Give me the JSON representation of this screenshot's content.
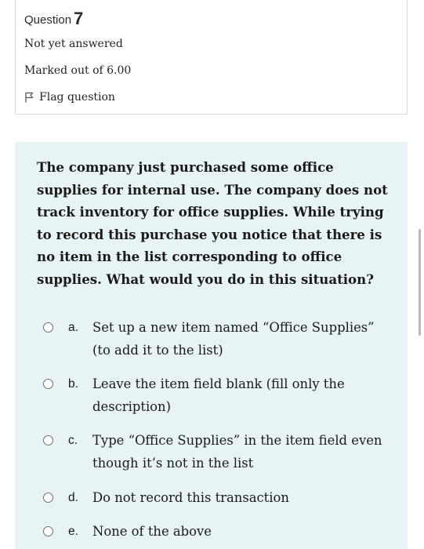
{
  "question_info": {
    "label": "Question",
    "number": "7",
    "state": "Not yet answered",
    "grade": "Marked out of 6.00",
    "flag_label": "Flag question"
  },
  "question_text": "The company just purchased some office supplies for internal use. The company does not track inventory for office supplies. While trying to record this purchase you notice that there is no item in the list corresponding to office supplies. What would you do in this situation?",
  "answers": [
    {
      "letter": "a.",
      "text": "Set up a new item named “Office Supplies” (to add it to the list)"
    },
    {
      "letter": "b.",
      "text": "Leave the item field blank (fill only the description)"
    },
    {
      "letter": "c.",
      "text": "Type “Office Supplies” in the item field even though it’s not in the list"
    },
    {
      "letter": "d.",
      "text": "Do not record this transaction"
    },
    {
      "letter": "e.",
      "text": "None of the above"
    }
  ],
  "colors": {
    "content_background": "#e7f3f5",
    "border": "#d6dbe0",
    "radio_border": "#6e6e6e"
  },
  "icons": {
    "flag": "flag-outline-icon",
    "radio": "radio-unchecked-icon"
  }
}
